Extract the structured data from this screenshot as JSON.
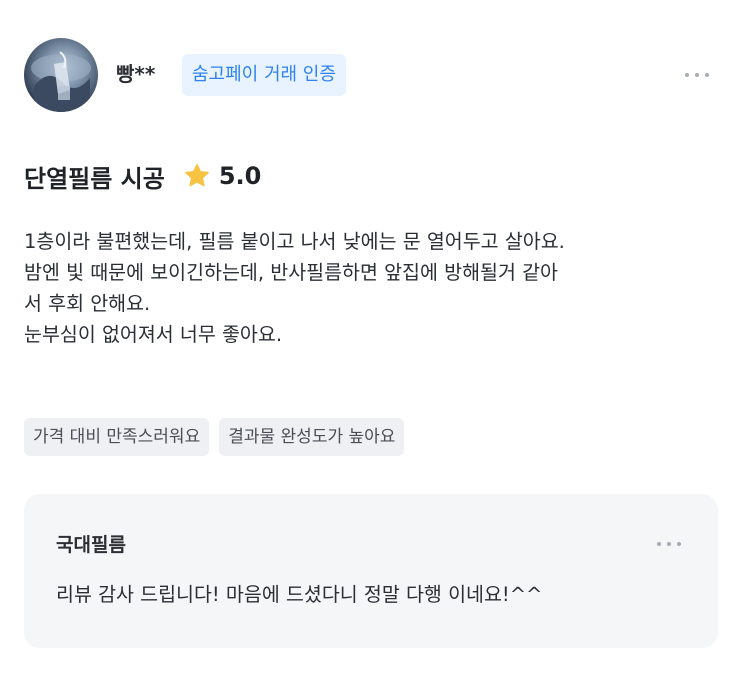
{
  "review": {
    "user": {
      "name": "빵**",
      "badge": "숨고페이 거래 인증",
      "avatar_icon": "profile-photo"
    },
    "service": "단열필름 시공",
    "rating": "5.0",
    "star_color": "#f6c343",
    "body_lines": [
      "1층이라 불편했는데, 필름 붙이고 나서 낮에는 문 열어두고 살아요.",
      "밤엔 빛 때문에 보이긴하는데, 반사필름하면 앞집에 방해될거 같아",
      "서 후회 안해요.",
      "눈부심이 없어져서 너무 좋아요."
    ],
    "tags": [
      "가격 대비 만족스러워요",
      "결과물 완성도가 높아요"
    ],
    "reply": {
      "author": "국대필름",
      "text": "리뷰 감사 드립니다! 마음에 드셨다니 정말 다행 이네요!^^"
    },
    "colors": {
      "badge_bg": "#e8f3ff",
      "badge_text": "#2f82ef",
      "tag_bg": "#eef0f3",
      "reply_bg": "#f4f6f8"
    }
  }
}
